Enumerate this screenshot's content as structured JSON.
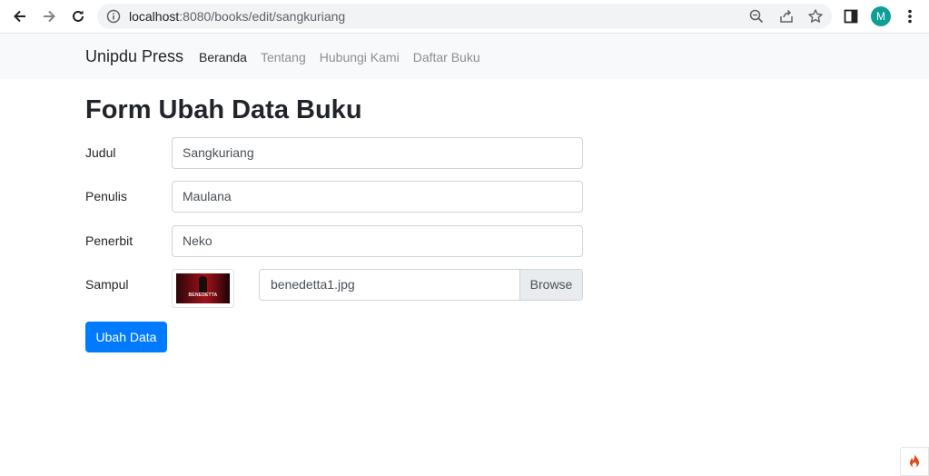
{
  "browser": {
    "url_host": "localhost",
    "url_rest": ":8080/books/edit/sangkuriang",
    "profile_initial": "M",
    "icons": [
      "back-icon",
      "forward-icon",
      "reload-icon",
      "info-icon",
      "zoom-icon",
      "share-icon",
      "star-icon",
      "sidepanel-icon",
      "menu-icon"
    ]
  },
  "navbar": {
    "brand": "Unipdu Press",
    "links": [
      {
        "label": "Beranda",
        "active": true
      },
      {
        "label": "Tentang",
        "active": false
      },
      {
        "label": "Hubungi Kami",
        "active": false
      },
      {
        "label": "Daftar Buku",
        "active": false
      }
    ]
  },
  "form": {
    "title": "Form Ubah Data Buku",
    "fields": [
      {
        "label": "Judul",
        "value": "Sangkuriang"
      },
      {
        "label": "Penulis",
        "value": "Maulana"
      },
      {
        "label": "Penerbit",
        "value": "Neko"
      }
    ],
    "cover": {
      "label": "Sampul",
      "thumbnail_text": "BENEDETTA",
      "file_name": "benedetta1.jpg",
      "browse_label": "Browse"
    },
    "submit_label": "Ubah Data"
  },
  "colors": {
    "primary": "#007bff",
    "navbar_bg": "#f8f9fa",
    "avatar": "#0f9d98"
  }
}
